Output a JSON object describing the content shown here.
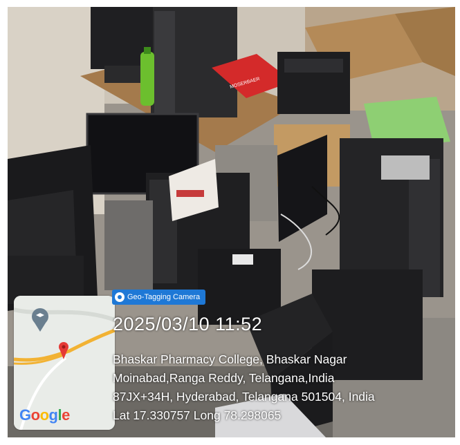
{
  "overlay": {
    "badge_label": "Geo-Tagging Camera",
    "datetime": "2025/03/10 11:52",
    "address_line1": "Bhaskar Pharmacy College, Bhaskar Nagar",
    "address_line2": "Moinabad,Ranga Reddy, Telangana,India",
    "address_line3": "87JX+34H, Hyderabad, Telangana 501504, India",
    "coordinates": "Lat 17.330757 Long 78.298065"
  },
  "map": {
    "logo_text": "Google",
    "logo_colors": [
      "#4285F4",
      "#EA4335",
      "#FBBC05",
      "#4285F4",
      "#34A853",
      "#EA4335"
    ]
  },
  "photo_labels": {
    "red_box_text": "MOSERBAER"
  },
  "colors": {
    "badge_bg": "#1e78d6",
    "pin_red": "#e53935",
    "road_yellow": "#f2b233"
  }
}
